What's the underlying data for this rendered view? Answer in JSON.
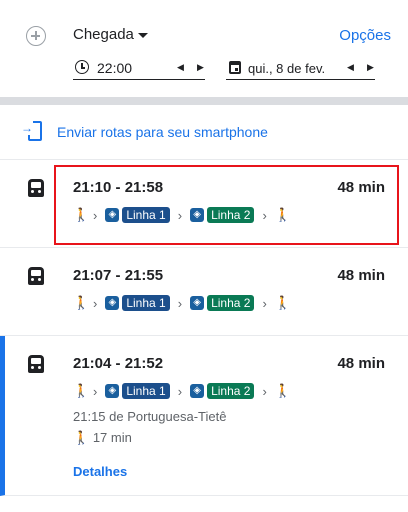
{
  "header": {
    "mode": "Chegada",
    "options": "Opções",
    "time": "22:00",
    "date": "qui., 8 de fev."
  },
  "send_to_phone": "Enviar rotas para seu smartphone",
  "routes": [
    {
      "times": "21:10 - 21:58",
      "duration": "48 min",
      "line1": "Linha 1",
      "line2": "Linha 2"
    },
    {
      "times": "21:07 - 21:55",
      "duration": "48 min",
      "line1": "Linha 1",
      "line2": "Linha 2"
    },
    {
      "times": "21:04 - 21:52",
      "duration": "48 min",
      "line1": "Linha 1",
      "line2": "Linha 2",
      "departure": "21:15 de Portuguesa-Tietê",
      "walk": "17 min",
      "details": "Detalhes"
    }
  ],
  "colors": {
    "accent": "#1a73e8",
    "line1": "#1c4f8c",
    "line2": "#0a7a55",
    "highlight": "#e8141b"
  },
  "icons": {
    "walk": "🚶",
    "chevron": "›",
    "metro": "◈"
  }
}
